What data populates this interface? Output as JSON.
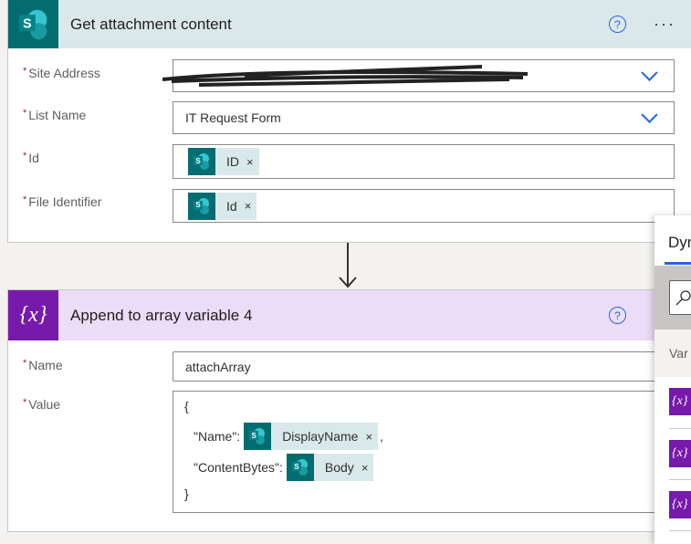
{
  "card1": {
    "title": "Get attachment content",
    "icon": "sharepoint-icon",
    "help": "?",
    "more": "···",
    "fields": [
      {
        "label": "Site Address",
        "value": ""
      },
      {
        "label": "List Name",
        "value": "IT Request Form"
      },
      {
        "label": "Id",
        "token": "ID"
      },
      {
        "label": "File Identifier",
        "token": "Id"
      }
    ]
  },
  "card2": {
    "title": "Append to array variable 4",
    "icon": "variable-icon",
    "icon_text": "{x}",
    "help": "?",
    "fields": [
      {
        "label": "Name",
        "value": "attachArray"
      },
      {
        "label": "Value"
      }
    ],
    "value_lines": {
      "open": "{",
      "name_key": "\"Name\":",
      "name_token": "DisplayName",
      "comma": ",",
      "bytes_key": "\"ContentBytes\":",
      "bytes_token": "Body",
      "close": "}"
    }
  },
  "panel": {
    "title": "Dyn",
    "section": "Var",
    "item_icon": "{x}"
  },
  "required_marker": "*",
  "token_close": "×",
  "colors": {
    "sharepoint": "#036c70",
    "variable": "#7719aa",
    "header1": "#dbe8e9",
    "header2": "#ebdcf7",
    "accent": "#2266e3"
  }
}
